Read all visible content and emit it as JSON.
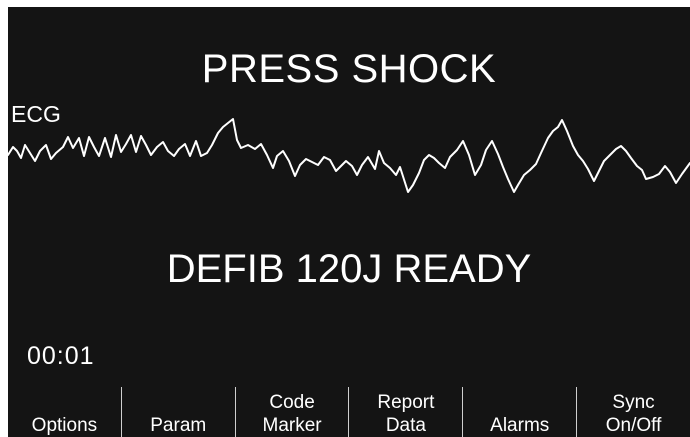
{
  "monitor": {
    "prompt": "PRESS SHOCK",
    "status": "DEFIB 120J READY",
    "elapsed_time": "00:01"
  },
  "ecg": {
    "label": "ECG",
    "trace_color": "#ffffff"
  },
  "colors": {
    "screen_background": "#141414",
    "text": "#ffffff"
  },
  "softkeys": [
    {
      "line1": "",
      "line2": "Options"
    },
    {
      "line1": "",
      "line2": "Param"
    },
    {
      "line1": "Code",
      "line2": "Marker"
    },
    {
      "line1": "Report",
      "line2": "Data"
    },
    {
      "line1": "",
      "line2": "Alarms"
    },
    {
      "line1": "Sync",
      "line2": "On/Off"
    }
  ]
}
